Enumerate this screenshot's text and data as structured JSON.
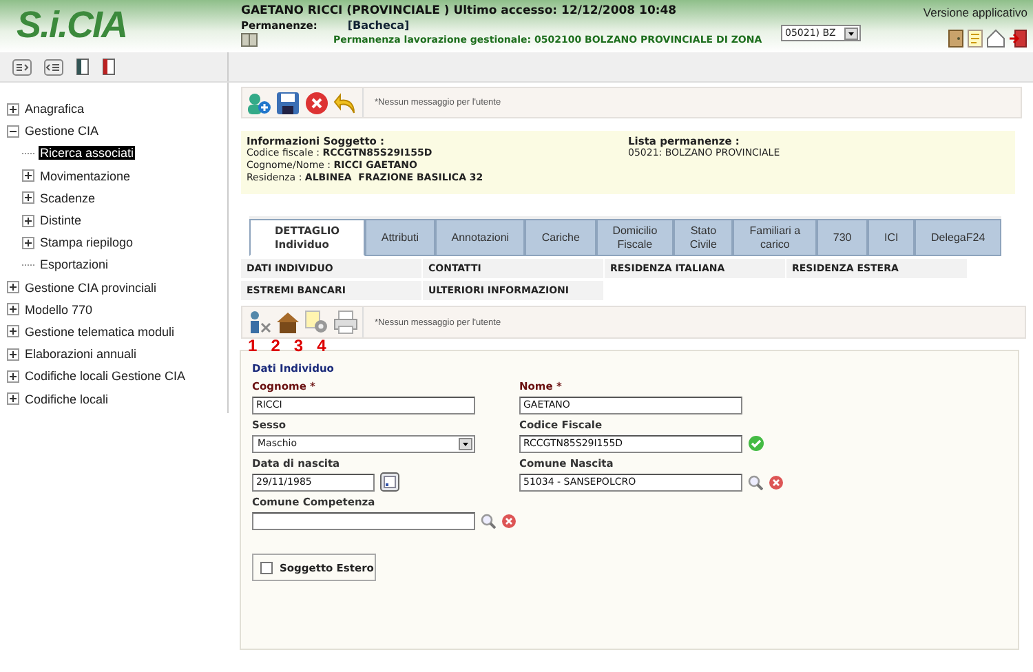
{
  "header": {
    "logo": "S.i.CIA",
    "user_line": "GAETANO RICCI (PROVINCIALE ) Ultimo accesso: 12/12/2008 10:48",
    "permanenze_label": "Permanenze:",
    "permanenze_value": "[Bacheca]",
    "permanenza_lavorazione": "Permanenza lavorazione gestionale: 0502100 BOLZANO PROVINCIALE DI ZONA",
    "office_select": "05021) BZ",
    "version": "Versione applicativo"
  },
  "sidebar": {
    "items": [
      {
        "label": "Anagrafica",
        "expanded": false,
        "selected": false
      },
      {
        "label": "Gestione CIA",
        "expanded": true,
        "selected": false,
        "children": [
          {
            "label": "Ricerca associati",
            "selected": true
          },
          {
            "label": "Movimentazione",
            "expanded": false,
            "selected": false
          },
          {
            "label": "Scadenze",
            "expanded": false,
            "selected": false
          },
          {
            "label": "Distinte",
            "expanded": false,
            "selected": false
          },
          {
            "label": "Stampa riepilogo",
            "expanded": false,
            "selected": false
          },
          {
            "label": "Esportazioni",
            "selected": false
          }
        ]
      },
      {
        "label": "Gestione CIA provinciali",
        "expanded": false,
        "selected": false
      },
      {
        "label": "Modello 770",
        "expanded": false,
        "selected": false
      },
      {
        "label": "Gestione telematica moduli",
        "expanded": false,
        "selected": false
      },
      {
        "label": "Elaborazioni annuali",
        "expanded": false,
        "selected": false
      },
      {
        "label": "Codifiche locali Gestione CIA",
        "expanded": false,
        "selected": false
      },
      {
        "label": "Codifiche locali",
        "expanded": false,
        "selected": false
      }
    ]
  },
  "toolbar": {
    "message": "*Nessun messaggio per l'utente"
  },
  "info": {
    "title": "Informazioni Soggetto :",
    "fields": [
      {
        "label": "Codice fiscale : ",
        "value": "RCCGTN85S29I155D"
      },
      {
        "label": "Cognome/Nome : ",
        "value": "RICCI GAETANO"
      },
      {
        "label": "Residenza : ",
        "value": "ALBINEA  FRAZIONE BASILICA 32"
      }
    ],
    "list_title": "Lista permanenze :",
    "list": [
      "05021: BOLZANO PROVINCIALE"
    ]
  },
  "tabs": [
    {
      "label": "DETTAGLIO\nIndividuo",
      "selected": true
    },
    {
      "label": "Attributi",
      "selected": false
    },
    {
      "label": "Annotazioni",
      "selected": false
    },
    {
      "label": "Cariche",
      "selected": false
    },
    {
      "label": "Domicilio\nFiscale",
      "selected": false
    },
    {
      "label": "Stato\nCivile",
      "selected": false
    },
    {
      "label": "Familiari a\ncarico",
      "selected": false
    },
    {
      "label": "730",
      "selected": false
    },
    {
      "label": "ICI",
      "selected": false
    },
    {
      "label": "DelegaF24",
      "selected": false
    }
  ],
  "subtabs": [
    "DATI INDIVIDUO",
    "CONTATTI",
    "RESIDENZA ITALIANA",
    "RESIDENZA ESTERA",
    "ESTREMI BANCARI",
    "ULTERIORI INFORMAZIONI"
  ],
  "detail_toolbar": {
    "message": "*Nessun messaggio per l'utente",
    "numbers": [
      "1",
      "2",
      "3",
      "4"
    ]
  },
  "form": {
    "title": "Dati Individuo",
    "fields": [
      {
        "label": "Cognome *",
        "required": true,
        "kind": "text",
        "value": "RICCI"
      },
      {
        "label": "Nome *",
        "required": true,
        "kind": "text",
        "value": "GAETANO"
      },
      {
        "label": "Sesso",
        "required": false,
        "kind": "select",
        "value": "Maschio"
      },
      {
        "label": "Codice Fiscale",
        "required": false,
        "kind": "valid",
        "value": "RCCGTN85S29I155D"
      },
      {
        "label": "Data di nascita",
        "required": false,
        "kind": "date",
        "value": "29/11/1985"
      },
      {
        "label": "Comune Nascita",
        "required": false,
        "kind": "lookup",
        "value": "51034 - SANSEPOLCRO"
      },
      {
        "label": "Comune Competenza",
        "required": false,
        "kind": "lookup"
      }
    ],
    "checkbox": {
      "label": "Soggetto Estero",
      "checked": false
    }
  }
}
